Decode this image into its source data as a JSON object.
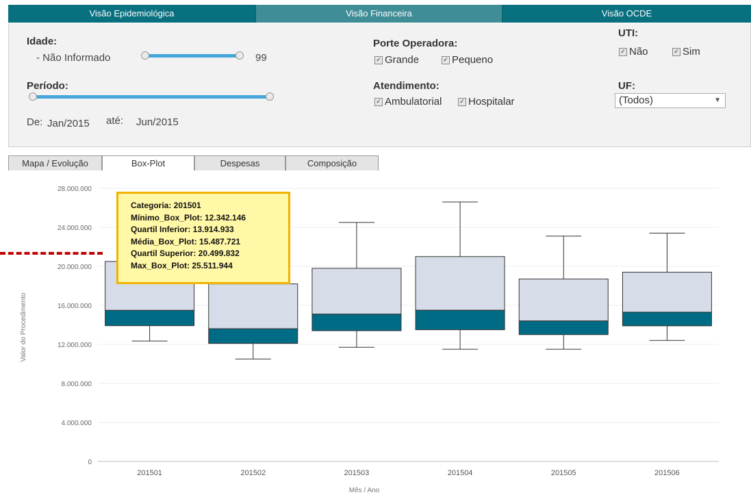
{
  "nav": {
    "tabs": [
      "Visão Epidemiológica",
      "Visão Financeira",
      "Visão OCDE"
    ],
    "active": 1
  },
  "filters": {
    "idade": {
      "label": "Idade:",
      "min_text": "- Não Informado",
      "max_text": "99"
    },
    "periodo": {
      "label": "Período:",
      "from_label": "De:",
      "from_value": "Jan/2015",
      "to_label": "até:",
      "to_value": "Jun/2015"
    },
    "porte": {
      "label": "Porte Operadora:",
      "options": [
        "Grande",
        "Pequeno"
      ]
    },
    "atendimento": {
      "label": "Atendimento:",
      "options": [
        "Ambulatorial",
        "Hospitalar"
      ]
    },
    "uti": {
      "label": "UTI:",
      "options": [
        "Não",
        "Sim"
      ]
    },
    "uf": {
      "label": "UF:",
      "value": "(Todos)"
    },
    "check_glyph": "✓"
  },
  "chart_tabs": {
    "tabs": [
      "Mapa / Evolução",
      "Box-Plot",
      "Despesas",
      "Composição"
    ],
    "active": 1
  },
  "colors": {
    "nav": "#08707f",
    "nav_active": "#3f8d97",
    "box_light": "#d6dce8",
    "box_dark": "#006b84",
    "tooltip_bg": "#fff8a6",
    "tooltip_border": "#f0b400",
    "dash": "#c00000"
  },
  "chart_data": {
    "type": "box",
    "xlabel": "Mês / Ano",
    "ylabel": "Valor do Procedimento",
    "ylim": [
      0,
      28000000
    ],
    "yticks": [
      "0",
      "4.000.000",
      "8.000.000",
      "12.000.000",
      "16.000.000",
      "20.000.000",
      "24.000.000",
      "28.000.000"
    ],
    "yticks_values": [
      0,
      4000000,
      8000000,
      12000000,
      16000000,
      20000000,
      24000000,
      28000000
    ],
    "grid": true,
    "categories": [
      "201501",
      "201502",
      "201503",
      "201504",
      "201505",
      "201506"
    ],
    "min": [
      12342146,
      10500000,
      11700000,
      11500000,
      11500000,
      12400000
    ],
    "q1": [
      13914933,
      12100000,
      13400000,
      13500000,
      13000000,
      13900000
    ],
    "mean": [
      15487721,
      13600000,
      15100000,
      15500000,
      14400000,
      15300000
    ],
    "q3": [
      20499832,
      18200000,
      19800000,
      21000000,
      18700000,
      19400000
    ],
    "max": [
      25511944,
      18200000,
      24500000,
      26600000,
      23100000,
      23400000
    ]
  },
  "tooltip": {
    "lines": [
      "Categoria: 201501",
      "Mínimo_Box_Plot: 12.342.146",
      "Quartil Inferior: 13.914.933",
      "Média_Box_Plot: 15.487.721",
      "Quartil Superior: 20.499.832",
      "Max_Box_Plot: 25.511.944"
    ]
  }
}
